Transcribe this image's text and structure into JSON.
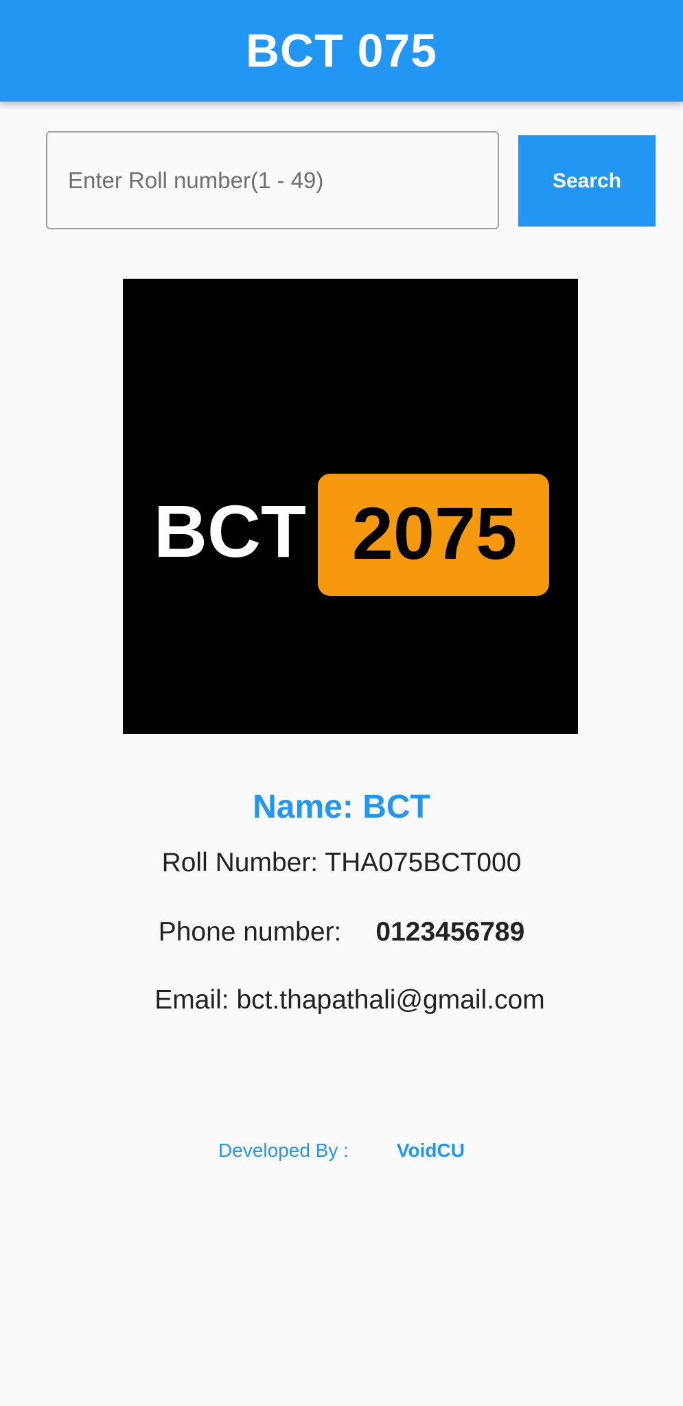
{
  "appbar": {
    "title": "BCT 075"
  },
  "search": {
    "placeholder": "Enter Roll number(1 - 49)",
    "value": "",
    "button_label": "Search"
  },
  "logo": {
    "left_text": "BCT",
    "right_text": "2075",
    "background_color": "#000000",
    "badge_color": "#f7990d",
    "text_color_left": "#ffffff",
    "text_color_right": "#000000"
  },
  "profile": {
    "name": "Name: BCT",
    "roll_label": "Roll Number: THA075BCT000",
    "phone_label": "Phone number:",
    "phone_value": "0123456789",
    "email_label": "Email: bct.thapathali@gmail.com"
  },
  "footer": {
    "label": "Developed By :",
    "value": "VoidCU"
  },
  "colors": {
    "primary": "#2196f3",
    "background": "#fafafa",
    "text": "#222222"
  }
}
